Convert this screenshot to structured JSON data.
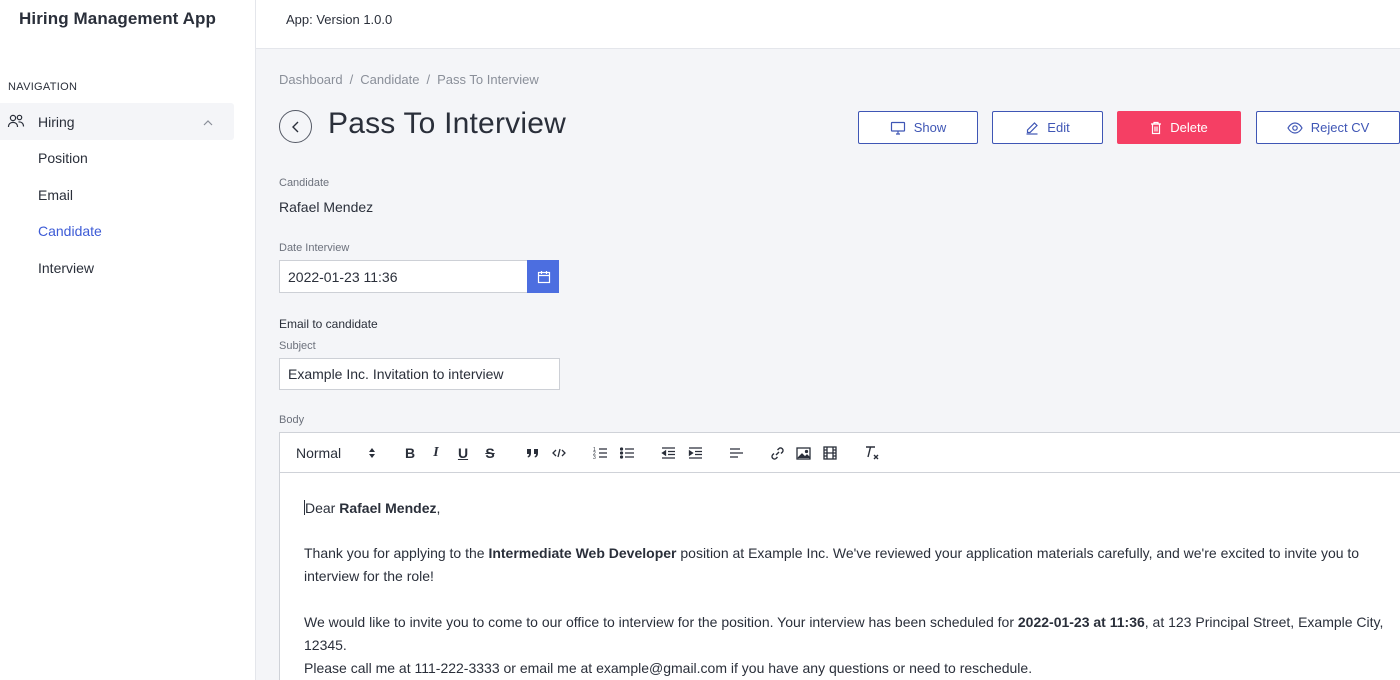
{
  "app": {
    "title": "Hiring Management App",
    "version": "App: Version 1.0.0"
  },
  "sidebar": {
    "heading": "NAVIGATION",
    "group": {
      "label": "Hiring",
      "icon": "users-icon",
      "expanded": true
    },
    "items": [
      {
        "label": "Position",
        "active": false
      },
      {
        "label": "Email",
        "active": false
      },
      {
        "label": "Candidate",
        "active": true
      },
      {
        "label": "Interview",
        "active": false
      }
    ]
  },
  "breadcrumb": [
    "Dashboard",
    "Candidate",
    "Pass To Interview"
  ],
  "page": {
    "title": "Pass To Interview"
  },
  "actions": {
    "show": "Show",
    "edit": "Edit",
    "delete": "Delete",
    "reject": "Reject CV"
  },
  "form": {
    "candidate_label": "Candidate",
    "candidate_value": "Rafael Mendez",
    "date_label": "Date Interview",
    "date_value": "2022-01-23 11:36",
    "email_section": "Email to candidate",
    "subject_label": "Subject",
    "subject_value": "Example Inc. Invitation to interview",
    "body_label": "Body"
  },
  "toolbar": {
    "format_select": "Normal"
  },
  "body": {
    "greeting_pre": "Dear ",
    "greeting_name": "Rafael Mendez",
    "greeting_post": ",",
    "p1_pre": "Thank you for applying to the ",
    "p1_bold": "Intermediate Web Developer",
    "p1_post": " position at Example Inc. We've reviewed your application materials carefully, and we're excited to invite you to interview for the role!",
    "p2_pre": "We would like to invite you to come to our office to interview for the position. Your interview has been scheduled for ",
    "p2_bold": "2022-01-23 at 11:36",
    "p2_post": ", at 123 Principal Street, Example City, 12345.",
    "p3": "Please call me at 111-222-3333 or email me at example@gmail.com if you have any questions or need to reschedule."
  },
  "colors": {
    "accent": "#3d5bd6",
    "danger": "#f53f64",
    "calendar": "#4c6ee0"
  }
}
